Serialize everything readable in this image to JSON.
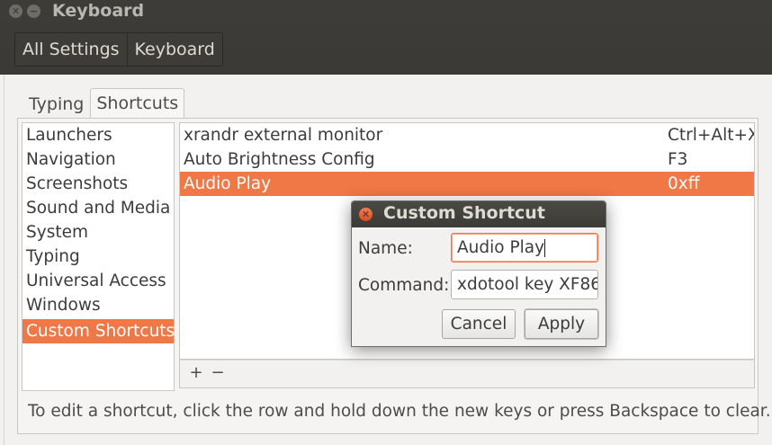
{
  "window": {
    "title": "Keyboard"
  },
  "breadcrumbs": [
    "All Settings",
    "Keyboard"
  ],
  "tabs": [
    {
      "label": "Typing",
      "active": false
    },
    {
      "label": "Shortcuts",
      "active": true
    }
  ],
  "categories": [
    {
      "label": "Launchers",
      "selected": false
    },
    {
      "label": "Navigation",
      "selected": false
    },
    {
      "label": "Screenshots",
      "selected": false
    },
    {
      "label": "Sound and Media",
      "selected": false
    },
    {
      "label": "System",
      "selected": false
    },
    {
      "label": "Typing",
      "selected": false
    },
    {
      "label": "Universal Access",
      "selected": false
    },
    {
      "label": "Windows",
      "selected": false
    },
    {
      "label": "Custom Shortcuts",
      "selected": true
    }
  ],
  "shortcuts": [
    {
      "name": "xrandr external monitor",
      "key": "Ctrl+Alt+X",
      "selected": false
    },
    {
      "name": "Auto Brightness Config",
      "key": "F3",
      "selected": false
    },
    {
      "name": "Audio Play",
      "key": "0xff",
      "selected": true
    }
  ],
  "toolbar": {
    "add": "+",
    "remove": "−"
  },
  "hint": "To edit a shortcut, click the row and hold down the new keys or press Backspace to clear.",
  "dialog": {
    "title": "Custom Shortcut",
    "name_label": "Name:",
    "name_value": "Audio Play",
    "command_label": "Command:",
    "command_value": "xdotool key XF86",
    "cancel": "Cancel",
    "apply": "Apply"
  },
  "colors": {
    "accent": "#f07746",
    "titlebar": "#3c3b37"
  },
  "icons": {
    "window_close": "close-icon",
    "window_minimize": "minimize-icon",
    "dialog_close": "close-icon"
  }
}
